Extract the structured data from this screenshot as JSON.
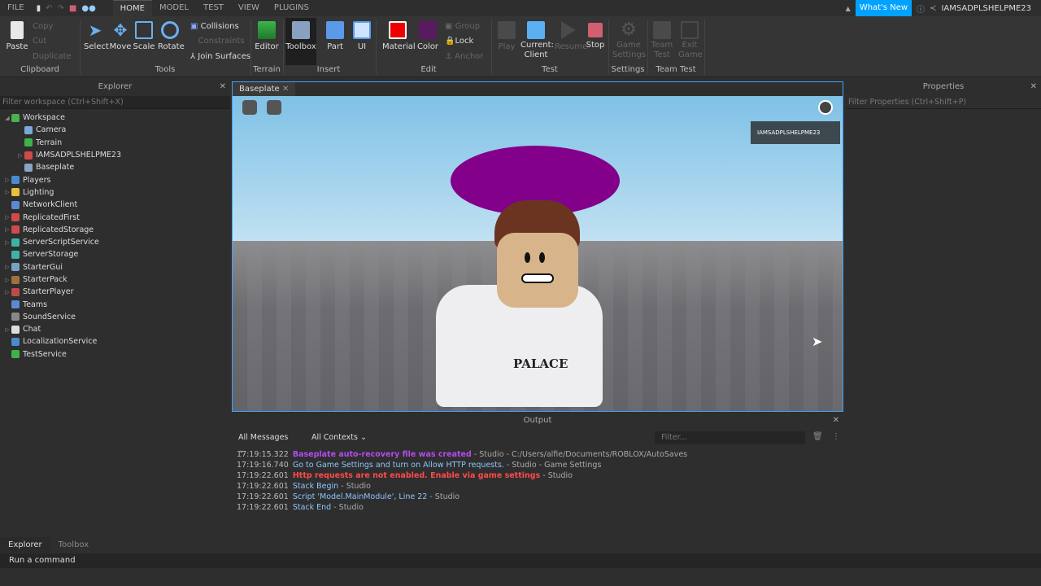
{
  "menubar": {
    "file": "FILE",
    "tabs": [
      "HOME",
      "MODEL",
      "TEST",
      "VIEW",
      "PLUGINS"
    ],
    "whats_new": "What's New",
    "username": "IAMSADPLSHELPME23"
  },
  "ribbon": {
    "clipboard": {
      "paste": "Paste",
      "copy": "Copy",
      "cut": "Cut",
      "duplicate": "Duplicate",
      "group": "Clipboard"
    },
    "tools": {
      "select": "Select",
      "move": "Move",
      "scale": "Scale",
      "rotate": "Rotate",
      "collisions": "Collisions",
      "constraints": "Constraints",
      "join_surfaces": "Join Surfaces",
      "group": "Tools"
    },
    "terrain": {
      "editor": "Editor",
      "group": "Terrain"
    },
    "insert": {
      "toolbox": "Toolbox",
      "part": "Part",
      "ui": "UI",
      "group": "Insert"
    },
    "edit": {
      "material": "Material",
      "color": "Color",
      "group_btn": "Group",
      "lock": "Lock",
      "anchor": "Anchor",
      "group": "Edit"
    },
    "test": {
      "play": "Play",
      "current_client": "Current:",
      "current_client2": "Client",
      "resume": "Resume",
      "stop": "Stop",
      "group": "Test"
    },
    "settings": {
      "game_settings": "Game",
      "game_settings2": "Settings",
      "group": "Settings"
    },
    "team_test": {
      "team_test": "Team",
      "team_test2": "Test",
      "exit_game": "Exit",
      "exit_game2": "Game",
      "group": "Team Test"
    }
  },
  "explorer": {
    "title": "Explorer",
    "filter_placeholder": "Filter workspace (Ctrl+Shift+X)",
    "items": [
      {
        "label": "Workspace",
        "depth": 0,
        "expanded": true,
        "color": "#4caf50"
      },
      {
        "label": "Camera",
        "depth": 1,
        "color": "#7aa8d8"
      },
      {
        "label": "Terrain",
        "depth": 1,
        "color": "#3cb44b"
      },
      {
        "label": "IAMSADPLSHELPME23",
        "depth": 1,
        "collapsed": true,
        "color": "#d04a4a"
      },
      {
        "label": "Baseplate",
        "depth": 1,
        "color": "#8aa4c8"
      },
      {
        "label": "Players",
        "depth": 0,
        "collapsed": true,
        "color": "#4a8ad0"
      },
      {
        "label": "Lighting",
        "depth": 0,
        "collapsed": true,
        "color": "#e8c040"
      },
      {
        "label": "NetworkClient",
        "depth": 0,
        "color": "#5a8ad0"
      },
      {
        "label": "ReplicatedFirst",
        "depth": 0,
        "collapsed": true,
        "color": "#d04a4a"
      },
      {
        "label": "ReplicatedStorage",
        "depth": 0,
        "collapsed": true,
        "color": "#d04a4a"
      },
      {
        "label": "ServerScriptService",
        "depth": 0,
        "collapsed": true,
        "color": "#3cb4a4"
      },
      {
        "label": "ServerStorage",
        "depth": 0,
        "color": "#3cb4a4"
      },
      {
        "label": "StarterGui",
        "depth": 0,
        "collapsed": true,
        "color": "#7aa0c8"
      },
      {
        "label": "StarterPack",
        "depth": 0,
        "collapsed": true,
        "color": "#a07040"
      },
      {
        "label": "StarterPlayer",
        "depth": 0,
        "collapsed": true,
        "color": "#c04a4a"
      },
      {
        "label": "Teams",
        "depth": 0,
        "color": "#5a8ad0"
      },
      {
        "label": "SoundService",
        "depth": 0,
        "color": "#888"
      },
      {
        "label": "Chat",
        "depth": 0,
        "collapsed": true,
        "color": "#ddd"
      },
      {
        "label": "LocalizationService",
        "depth": 0,
        "color": "#4a8ad0"
      },
      {
        "label": "TestService",
        "depth": 0,
        "color": "#3cb44b"
      }
    ]
  },
  "viewport": {
    "tab": "Baseplate",
    "player_tag": "IAMSADPLSHELPME23",
    "shirt_text": "PALACE"
  },
  "output": {
    "title": "Output",
    "filter1": "All Messages",
    "filter2": "All Contexts",
    "filter_placeholder": "Filter...",
    "logs": [
      {
        "time": "17:19:15.322",
        "msg": "Baseplate auto-recovery file was created",
        "src": " - Studio - C:/Users/alfie/Documents/ROBLOX/AutoSaves",
        "color": "#b44bf0",
        "bold": true
      },
      {
        "time": "17:19:16.740",
        "msg": "Go to Game Settings and turn on Allow HTTP requests.",
        "src": " - Studio - Game Settings",
        "color": "#8cc6ff",
        "bold": false
      },
      {
        "time": "17:19:22.601",
        "msg": "Http requests are not enabled. Enable via game settings",
        "src": " - Studio",
        "color": "#ff4a4a",
        "bold": true
      },
      {
        "time": "17:19:22.601",
        "msg": "Stack Begin",
        "src": " - Studio",
        "color": "#8cc6ff",
        "bold": false
      },
      {
        "time": "17:19:22.601",
        "msg": "Script 'Model.MainModule', Line 22",
        "src": " - Studio",
        "color": "#8cc6ff",
        "bold": false
      },
      {
        "time": "17:19:22.601",
        "msg": "Stack End",
        "src": " - Studio",
        "color": "#8cc6ff",
        "bold": false
      }
    ]
  },
  "properties": {
    "title": "Properties",
    "filter_placeholder": "Filter Properties (Ctrl+Shift+P)"
  },
  "bottom_tabs": [
    "Explorer",
    "Toolbox"
  ],
  "command_bar": {
    "placeholder": "Run a command"
  }
}
